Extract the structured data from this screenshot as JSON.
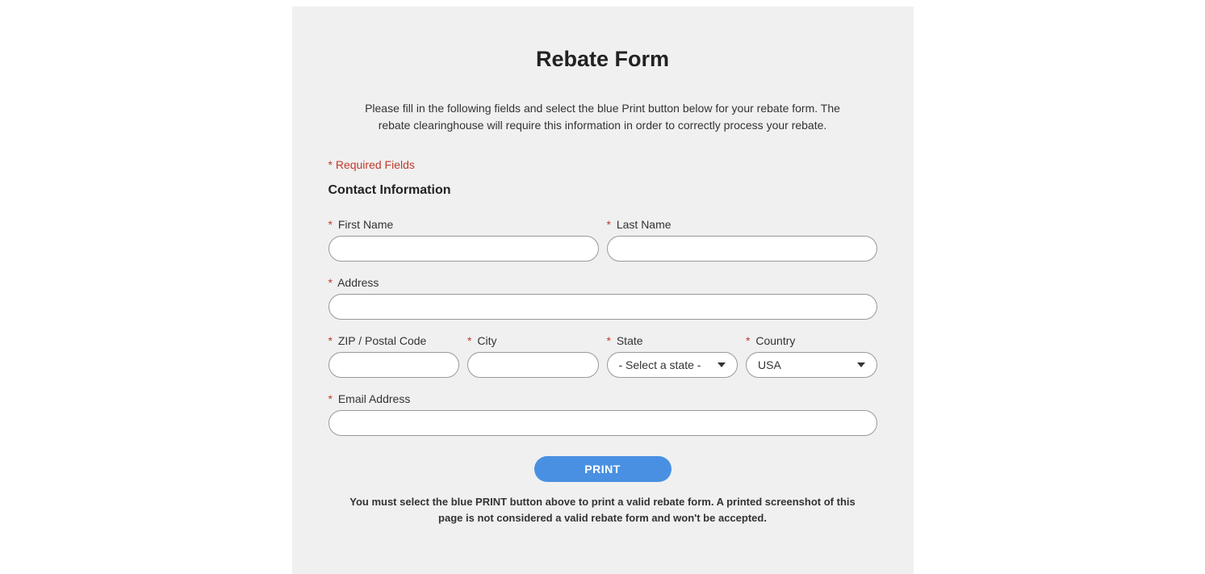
{
  "page": {
    "title": "Rebate Form",
    "instructions": "Please fill in the following fields and select the blue Print button below for your rebate form. The rebate clearinghouse will require this information in order to correctly process your rebate.",
    "requiredNote": "* Required Fields",
    "sectionTitle": "Contact Information",
    "footerNote": "You must select the blue PRINT button above to print a valid rebate form. A printed screenshot of this page is not considered a valid rebate form and won't be accepted."
  },
  "fields": {
    "firstName": {
      "label": "First Name",
      "value": ""
    },
    "lastName": {
      "label": "Last Name",
      "value": ""
    },
    "address": {
      "label": "Address",
      "value": ""
    },
    "zip": {
      "label": "ZIP / Postal Code",
      "value": ""
    },
    "city": {
      "label": "City",
      "value": ""
    },
    "state": {
      "label": "State",
      "selected": "- Select a state -"
    },
    "country": {
      "label": "Country",
      "selected": "USA"
    },
    "email": {
      "label": "Email Address",
      "value": ""
    }
  },
  "buttons": {
    "print": "PRINT"
  }
}
